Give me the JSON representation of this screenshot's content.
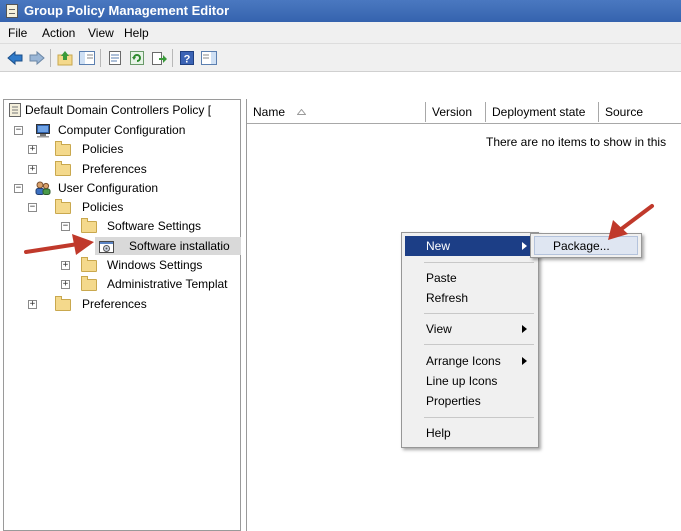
{
  "window": {
    "title": "Group Policy Management Editor"
  },
  "menu": [
    "File",
    "Action",
    "View",
    "Help"
  ],
  "toolbar": {
    "icons": [
      "back-arrow-icon",
      "forward-arrow-icon",
      "up-folder-icon",
      "show-hide-tree-icon",
      "properties-icon",
      "refresh-icon",
      "export-list-icon",
      "help-icon",
      "show-hide-action-pane-icon"
    ]
  },
  "tree": {
    "root": "Default Domain Controllers Policy [",
    "computer_config": "Computer Configuration",
    "cc_policies": "Policies",
    "cc_preferences": "Preferences",
    "user_config": "User Configuration",
    "uc_policies": "Policies",
    "software_settings": "Software Settings",
    "software_installation": "Software installatio",
    "windows_settings": "Windows Settings",
    "admin_templates": "Administrative Templat",
    "uc_preferences": "Preferences",
    "expanders": {
      "plus": "+",
      "minus": "−"
    }
  },
  "list": {
    "columns": [
      "Name",
      "Version",
      "Deployment state",
      "Source"
    ],
    "empty_message": "There are no items to show in this"
  },
  "context_menu": {
    "new": "New",
    "paste": "Paste",
    "refresh": "Refresh",
    "view": "View",
    "arrange_icons": "Arrange Icons",
    "line_up_icons": "Line up Icons",
    "properties": "Properties",
    "help": "Help"
  },
  "submenu": {
    "package": "Package..."
  },
  "colors": {
    "title_bar": "#3563ae",
    "menu_highlight": "#1c3e86",
    "annotation_arrow": "#c0392b"
  }
}
